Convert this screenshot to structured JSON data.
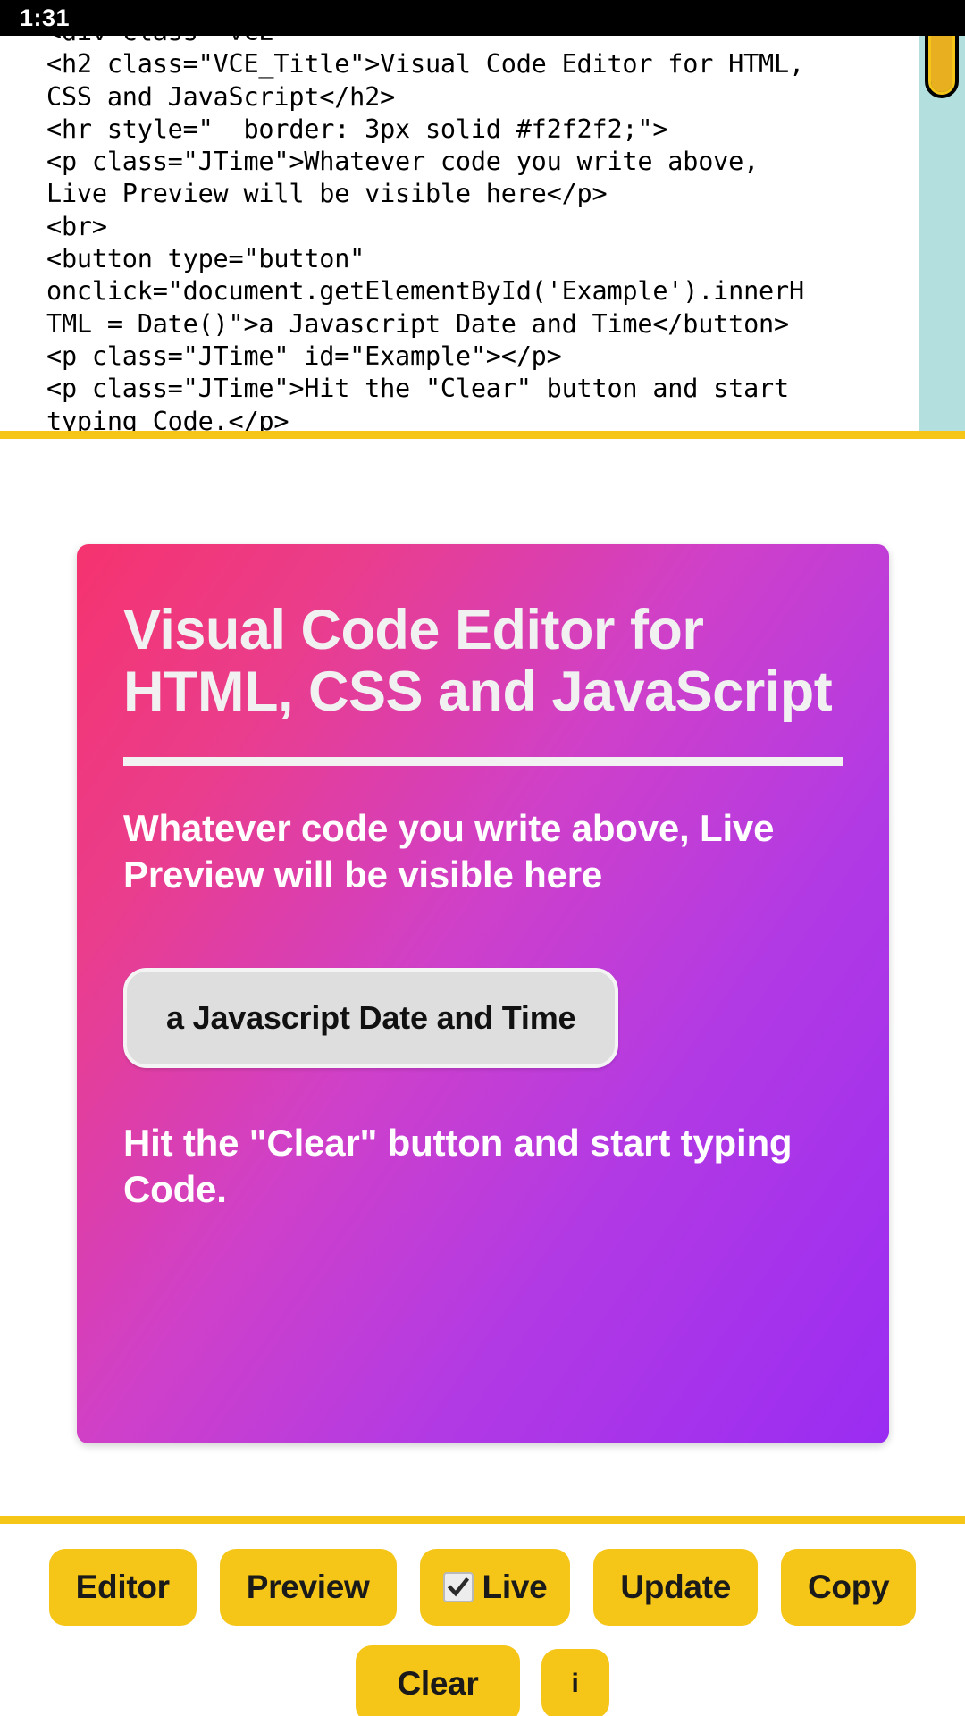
{
  "status_bar": {
    "time": "1:31"
  },
  "editor": {
    "code_lines": [
      "<div class=\"VCE\"",
      "<h2 class=\"VCE_Title\">Visual Code Editor for HTML,",
      "CSS and JavaScript</h2>",
      "<hr style=\"  border: 3px solid #f2f2f2;\">",
      "<p class=\"JTime\">Whatever code you write above,",
      "Live Preview will be visible here</p>",
      "<br>",
      "<button type=\"button\"",
      "onclick=\"document.getElementById('Example').innerH",
      "TML = Date()\">a Javascript Date and Time</button>",
      "<p class=\"JTime\" id=\"Example\"></p>",
      "<p class=\"JTime\">Hit the \"Clear\" button and start",
      "typing Code.</p>"
    ],
    "scrollbar": {
      "track_color": "#b3dfdf",
      "thumb_color": "#e8b021"
    }
  },
  "preview": {
    "title": "Visual Code Editor for HTML, CSS and JavaScript",
    "paragraph_1": "Whatever code you write above, Live Preview will be visible here",
    "date_button_label": "a Javascript Date and Time",
    "example_output": "",
    "paragraph_2": "Hit the \"Clear\" button and start typing Code.",
    "gradient_from": "#f5336f",
    "gradient_to": "#9a2cf2",
    "hr_color": "#f2f2f2"
  },
  "toolbar": {
    "accent_color": "#f5c518",
    "row_one": [
      {
        "label": "Editor",
        "name": "editor-button",
        "checkbox": false
      },
      {
        "label": "Preview",
        "name": "preview-button",
        "checkbox": false
      },
      {
        "label": "Live",
        "name": "live-toggle-button",
        "checkbox": true,
        "checked": true
      },
      {
        "label": "Update",
        "name": "update-button",
        "checkbox": false
      },
      {
        "label": "Copy",
        "name": "copy-button",
        "checkbox": false
      }
    ],
    "row_two": [
      {
        "label": "Clear",
        "name": "clear-button"
      },
      {
        "label": "i",
        "name": "info-button"
      }
    ]
  }
}
